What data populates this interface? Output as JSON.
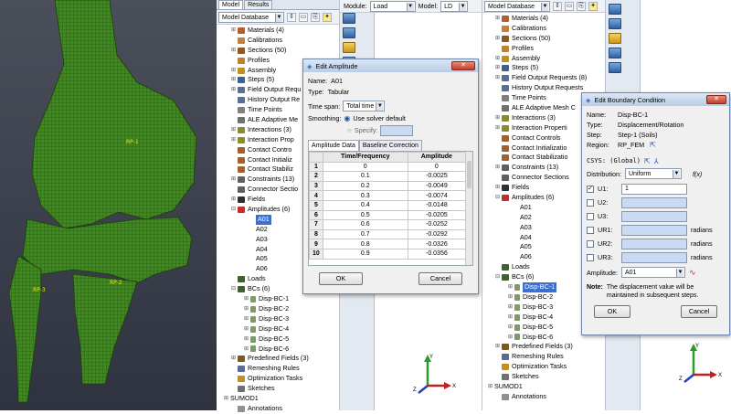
{
  "left_tree": {
    "tabs": [
      "Model",
      "Results"
    ],
    "db_label": "Model Database",
    "items": [
      {
        "exp": "⊞",
        "label": "Materials (4)",
        "color": "#b06030"
      },
      {
        "exp": "",
        "label": "Calibrations",
        "color": "#c08040"
      },
      {
        "exp": "⊞",
        "label": "Sections (50)",
        "color": "#8a5a20"
      },
      {
        "exp": "",
        "label": "Profiles",
        "color": "#c08030"
      },
      {
        "exp": "⊞",
        "label": "Assembly",
        "color": "#c09020"
      },
      {
        "exp": "⊞",
        "label": "Steps (5)",
        "color": "#406090"
      },
      {
        "exp": "⊞",
        "label": "Field Output Requ",
        "color": "#5a7090"
      },
      {
        "exp": "",
        "label": "History Output Re",
        "color": "#5a7090"
      },
      {
        "exp": "",
        "label": "Time Points",
        "color": "#808080"
      },
      {
        "exp": "",
        "label": "ALE Adaptive Me",
        "color": "#707070"
      },
      {
        "exp": "⊞",
        "label": "Interactions (3)",
        "color": "#8a8a30"
      },
      {
        "exp": "⊞",
        "label": "Interaction Prop",
        "color": "#8a8a30"
      },
      {
        "exp": "",
        "label": "Contact Contro",
        "color": "#a06030"
      },
      {
        "exp": "",
        "label": "Contact Initializ",
        "color": "#a06030"
      },
      {
        "exp": "",
        "label": "Contact Stabiliz",
        "color": "#a06030"
      },
      {
        "exp": "⊞",
        "label": "Constraints (13)",
        "color": "#606060"
      },
      {
        "exp": "",
        "label": "Connector Sectio",
        "color": "#606060"
      },
      {
        "exp": "⊞",
        "label": "Fields",
        "color": "#303030"
      },
      {
        "exp": "⊟",
        "label": "Amplitudes (6)",
        "color": "#c03030"
      },
      {
        "exp": "",
        "label": "A01",
        "color": "",
        "selected": true
      },
      {
        "exp": "",
        "label": "A02",
        "color": ""
      },
      {
        "exp": "",
        "label": "A03",
        "color": ""
      },
      {
        "exp": "",
        "label": "A04",
        "color": ""
      },
      {
        "exp": "",
        "label": "A05",
        "color": ""
      },
      {
        "exp": "",
        "label": "A06",
        "color": ""
      },
      {
        "exp": "",
        "label": "Loads",
        "color": "#406030"
      },
      {
        "exp": "⊟",
        "label": "BCs (6)",
        "color": "#406030"
      },
      {
        "exp": "⊞",
        "label": "Disp-BC-1",
        "color": ""
      },
      {
        "exp": "⊞",
        "label": "Disp-BC-2",
        "color": ""
      },
      {
        "exp": "⊞",
        "label": "Disp-BC-3",
        "color": ""
      },
      {
        "exp": "⊞",
        "label": "Disp-BC-4",
        "color": ""
      },
      {
        "exp": "⊞",
        "label": "Disp-BC-5",
        "color": ""
      },
      {
        "exp": "⊞",
        "label": "Disp-BC-6",
        "color": ""
      },
      {
        "exp": "⊞",
        "label": "Predefined Fields (3)",
        "color": "#7a5a20"
      },
      {
        "exp": "",
        "label": "Remeshing Rules",
        "color": "#5a6a90"
      },
      {
        "exp": "",
        "label": "Optimization Tasks",
        "color": "#c09020"
      },
      {
        "exp": "",
        "label": "Sketches",
        "color": "#707070"
      },
      {
        "exp": "⊞",
        "label": "SUMOD1",
        "color": ""
      },
      {
        "exp": "",
        "label": "Annotations",
        "color": "#909090"
      }
    ]
  },
  "module_bar": {
    "module_label": "Module:",
    "module_value": "Load",
    "model_label": "Model:",
    "model_value": "LD",
    "db_label": "Model Database"
  },
  "right_tree": {
    "items": [
      {
        "exp": "⊞",
        "label": "Materials (4)",
        "color": "#b06030"
      },
      {
        "exp": "",
        "label": "Calibrations",
        "color": "#c08040"
      },
      {
        "exp": "⊞",
        "label": "Sections (50)",
        "color": "#8a5a20"
      },
      {
        "exp": "",
        "label": "Profiles",
        "color": "#c08030"
      },
      {
        "exp": "⊞",
        "label": "Assembly",
        "color": "#c09020"
      },
      {
        "exp": "⊞",
        "label": "Steps (5)",
        "color": "#406090"
      },
      {
        "exp": "⊞",
        "label": "Field Output Requests (8)",
        "color": "#5a7090"
      },
      {
        "exp": "",
        "label": "History Output Requests",
        "color": "#5a7090"
      },
      {
        "exp": "",
        "label": "Time Points",
        "color": "#808080"
      },
      {
        "exp": "",
        "label": "ALE Adaptive Mesh C",
        "color": "#707070"
      },
      {
        "exp": "⊞",
        "label": "Interactions (3)",
        "color": "#8a8a30"
      },
      {
        "exp": "⊞",
        "label": "Interaction Properti",
        "color": "#8a8a30"
      },
      {
        "exp": "",
        "label": "Contact Controls",
        "color": "#a06030"
      },
      {
        "exp": "",
        "label": "Contact Initializatio",
        "color": "#a06030"
      },
      {
        "exp": "",
        "label": "Contact Stabilizatio",
        "color": "#a06030"
      },
      {
        "exp": "⊞",
        "label": "Constraints (13)",
        "color": "#606060"
      },
      {
        "exp": "",
        "label": "Connector Sections",
        "color": "#606060"
      },
      {
        "exp": "⊞",
        "label": "Fields",
        "color": "#303030"
      },
      {
        "exp": "⊟",
        "label": "Amplitudes (6)",
        "color": "#c03030"
      },
      {
        "exp": "",
        "label": "A01",
        "color": ""
      },
      {
        "exp": "",
        "label": "A02",
        "color": ""
      },
      {
        "exp": "",
        "label": "A03",
        "color": ""
      },
      {
        "exp": "",
        "label": "A04",
        "color": ""
      },
      {
        "exp": "",
        "label": "A05",
        "color": ""
      },
      {
        "exp": "",
        "label": "A06",
        "color": ""
      },
      {
        "exp": "",
        "label": "Loads",
        "color": "#406030"
      },
      {
        "exp": "⊟",
        "label": "BCs (6)",
        "color": "#406030"
      },
      {
        "exp": "⊞",
        "label": "Disp-BC-1",
        "color": "",
        "selected": true
      },
      {
        "exp": "⊞",
        "label": "Disp-BC-2",
        "color": ""
      },
      {
        "exp": "⊞",
        "label": "Disp-BC-3",
        "color": ""
      },
      {
        "exp": "⊞",
        "label": "Disp-BC-4",
        "color": ""
      },
      {
        "exp": "⊞",
        "label": "Disp-BC-5",
        "color": ""
      },
      {
        "exp": "⊞",
        "label": "Disp-BC-6",
        "color": ""
      },
      {
        "exp": "⊞",
        "label": "Predefined Fields (3)",
        "color": "#7a5a20"
      },
      {
        "exp": "",
        "label": "Remeshing Rules",
        "color": "#5a6a90"
      },
      {
        "exp": "",
        "label": "Optimization Tasks",
        "color": "#c09020"
      },
      {
        "exp": "",
        "label": "Sketches",
        "color": "#707070"
      },
      {
        "exp": "⊞",
        "label": "SUMOD1",
        "color": ""
      },
      {
        "exp": "",
        "label": "Annotations",
        "color": "#909090"
      }
    ]
  },
  "viewport_labels": {
    "rp1": "RP-1",
    "rp2": "RP-2",
    "rp3": "RP-3"
  },
  "axes": {
    "x": "X",
    "y": "Y",
    "z": "Z"
  },
  "amplitude_dialog": {
    "title": "Edit Amplitude",
    "name_label": "Name:",
    "name_value": "A01",
    "type_label": "Type:",
    "type_value": "Tabular",
    "time_span_label": "Time span:",
    "time_span_value": "Total time",
    "smoothing_label": "Smoothing:",
    "opt_solver": "Use solver default",
    "opt_specify": "Specify:",
    "tab_data": "Amplitude Data",
    "tab_baseline": "Baseline Correction",
    "col_time": "Time/Frequency",
    "col_amp": "Amplitude",
    "rows": [
      {
        "i": "1",
        "t": "0",
        "a": "0"
      },
      {
        "i": "2",
        "t": "0.1",
        "a": "-0.0025"
      },
      {
        "i": "3",
        "t": "0.2",
        "a": "-0.0049"
      },
      {
        "i": "4",
        "t": "0.3",
        "a": "-0.0074"
      },
      {
        "i": "5",
        "t": "0.4",
        "a": "-0.0148"
      },
      {
        "i": "6",
        "t": "0.5",
        "a": "-0.0205"
      },
      {
        "i": "7",
        "t": "0.6",
        "a": "-0.0252"
      },
      {
        "i": "8",
        "t": "0.7",
        "a": "-0.0292"
      },
      {
        "i": "9",
        "t": "0.8",
        "a": "-0.0326"
      },
      {
        "i": "10",
        "t": "0.9",
        "a": "-0.0356"
      }
    ],
    "ok": "OK",
    "cancel": "Cancel"
  },
  "bc_dialog": {
    "title": "Edit Boundary Condition",
    "name_label": "Name:",
    "name_value": "Disp-BC-1",
    "type_label": "Type:",
    "type_value": "Displacement/Rotation",
    "step_label": "Step:",
    "step_value": "Step-1 (Soils)",
    "region_label": "Region:",
    "region_value": "RP_FEM",
    "csys_label": "CSYS: (Global)",
    "dist_label": "Distribution:",
    "dist_value": "Uniform",
    "fx_label": "f(x)",
    "fields": [
      {
        "label": "U1:",
        "value": "1",
        "checked": true,
        "unit": ""
      },
      {
        "label": "U2:",
        "value": "",
        "checked": false,
        "unit": ""
      },
      {
        "label": "U3:",
        "value": "",
        "checked": false,
        "unit": ""
      },
      {
        "label": "UR1:",
        "value": "",
        "checked": false,
        "unit": "radians"
      },
      {
        "label": "UR2:",
        "value": "",
        "checked": false,
        "unit": "radians"
      },
      {
        "label": "UR3:",
        "value": "",
        "checked": false,
        "unit": "radians"
      }
    ],
    "amp_label": "Amplitude:",
    "amp_value": "A01",
    "note_label": "Note:",
    "note_text": "The displacement value will be maintained in subsequent steps.",
    "ok": "OK",
    "cancel": "Cancel"
  }
}
